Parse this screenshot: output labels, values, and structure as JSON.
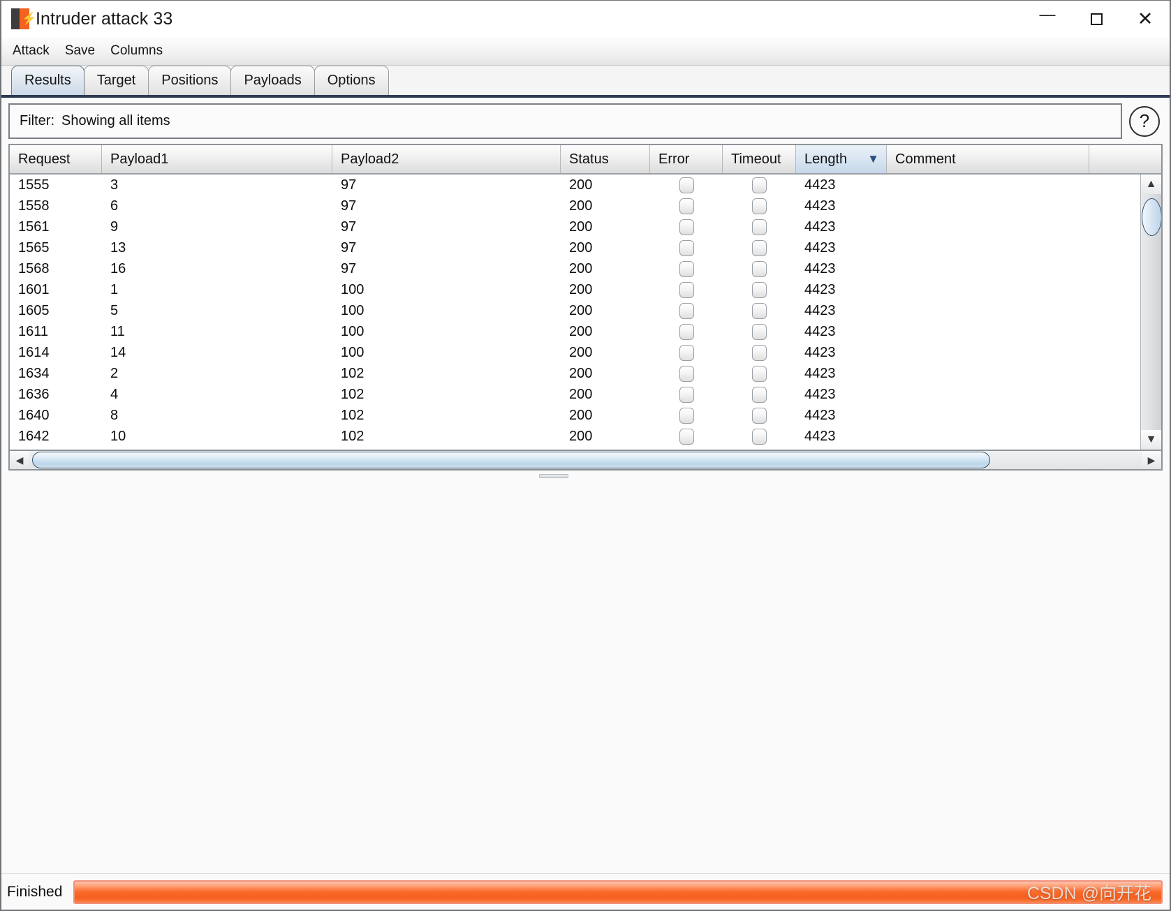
{
  "window": {
    "title": "Intruder attack 33",
    "icon": "burp-logo-icon",
    "minimize": "—",
    "maximize": "□",
    "close": "✕"
  },
  "menubar": {
    "items": [
      {
        "label": "Attack"
      },
      {
        "label": "Save"
      },
      {
        "label": "Columns"
      }
    ]
  },
  "tabs": [
    {
      "label": "Results",
      "active": true
    },
    {
      "label": "Target",
      "active": false
    },
    {
      "label": "Positions",
      "active": false
    },
    {
      "label": "Payloads",
      "active": false
    },
    {
      "label": "Options",
      "active": false
    }
  ],
  "filter": {
    "label": "Filter:",
    "value": "Showing all items",
    "help_glyph": "?"
  },
  "table": {
    "columns": [
      {
        "key": "request",
        "label": "Request",
        "sorted": false
      },
      {
        "key": "payload1",
        "label": "Payload1",
        "sorted": false
      },
      {
        "key": "payload2",
        "label": "Payload2",
        "sorted": false
      },
      {
        "key": "status",
        "label": "Status",
        "sorted": false
      },
      {
        "key": "error",
        "label": "Error",
        "sorted": false
      },
      {
        "key": "timeout",
        "label": "Timeout",
        "sorted": false
      },
      {
        "key": "length",
        "label": "Length",
        "sorted": true,
        "sort_direction": "desc",
        "sort_glyph": "▼"
      },
      {
        "key": "comment",
        "label": "Comment",
        "sorted": false
      }
    ],
    "rows": [
      {
        "request": "1555",
        "payload1": "3",
        "payload2": "97",
        "status": "200",
        "error": false,
        "timeout": false,
        "length": "4423",
        "comment": ""
      },
      {
        "request": "1558",
        "payload1": "6",
        "payload2": "97",
        "status": "200",
        "error": false,
        "timeout": false,
        "length": "4423",
        "comment": ""
      },
      {
        "request": "1561",
        "payload1": "9",
        "payload2": "97",
        "status": "200",
        "error": false,
        "timeout": false,
        "length": "4423",
        "comment": ""
      },
      {
        "request": "1565",
        "payload1": "13",
        "payload2": "97",
        "status": "200",
        "error": false,
        "timeout": false,
        "length": "4423",
        "comment": ""
      },
      {
        "request": "1568",
        "payload1": "16",
        "payload2": "97",
        "status": "200",
        "error": false,
        "timeout": false,
        "length": "4423",
        "comment": ""
      },
      {
        "request": "1601",
        "payload1": "1",
        "payload2": "100",
        "status": "200",
        "error": false,
        "timeout": false,
        "length": "4423",
        "comment": ""
      },
      {
        "request": "1605",
        "payload1": "5",
        "payload2": "100",
        "status": "200",
        "error": false,
        "timeout": false,
        "length": "4423",
        "comment": ""
      },
      {
        "request": "1611",
        "payload1": "11",
        "payload2": "100",
        "status": "200",
        "error": false,
        "timeout": false,
        "length": "4423",
        "comment": ""
      },
      {
        "request": "1614",
        "payload1": "14",
        "payload2": "100",
        "status": "200",
        "error": false,
        "timeout": false,
        "length": "4423",
        "comment": ""
      },
      {
        "request": "1634",
        "payload1": "2",
        "payload2": "102",
        "status": "200",
        "error": false,
        "timeout": false,
        "length": "4423",
        "comment": ""
      },
      {
        "request": "1636",
        "payload1": "4",
        "payload2": "102",
        "status": "200",
        "error": false,
        "timeout": false,
        "length": "4423",
        "comment": ""
      },
      {
        "request": "1640",
        "payload1": "8",
        "payload2": "102",
        "status": "200",
        "error": false,
        "timeout": false,
        "length": "4423",
        "comment": ""
      },
      {
        "request": "1642",
        "payload1": "10",
        "payload2": "102",
        "status": "200",
        "error": false,
        "timeout": false,
        "length": "4423",
        "comment": ""
      }
    ]
  },
  "scrollbars": {
    "vertical": {
      "up_glyph": "▲",
      "down_glyph": "▼"
    },
    "horizontal": {
      "left_glyph": "◀",
      "right_glyph": "▶"
    }
  },
  "statusbar": {
    "status": "Finished",
    "progress_percent": 100,
    "watermark": "CSDN @向开花"
  },
  "colors": {
    "accent_progress": "#f4601f",
    "sorted_header": "#c6d7ea",
    "tab_active": "#ccd9e8",
    "tabstrip_underline": "#2c3a54"
  }
}
